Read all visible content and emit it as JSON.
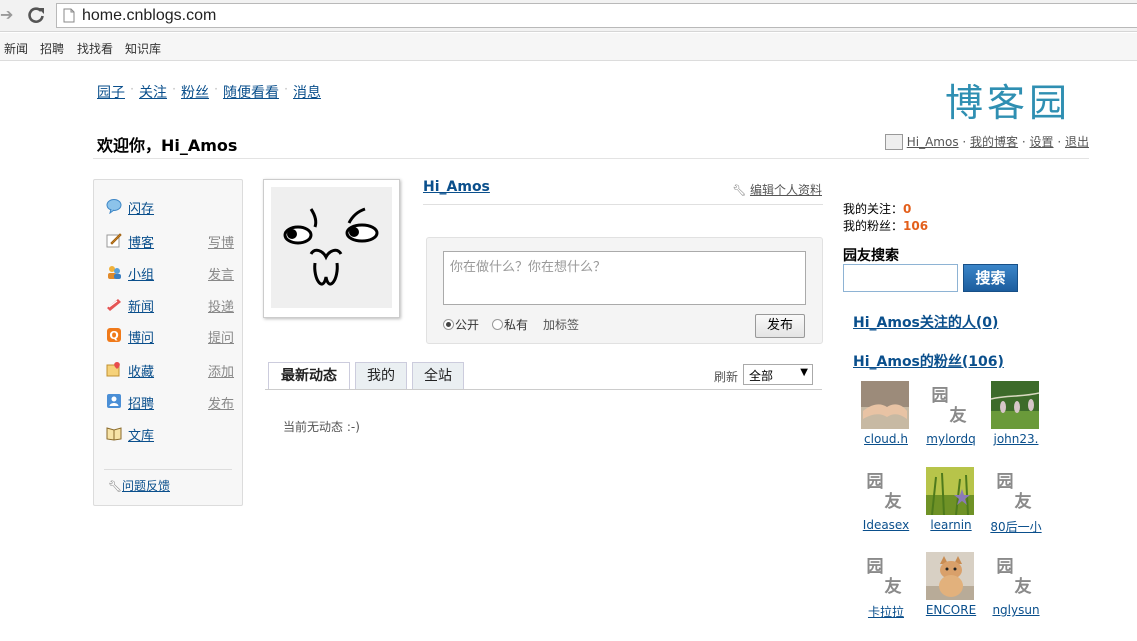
{
  "browser": {
    "url": "home.cnblogs.com",
    "bookmarks": [
      "新闻",
      "招聘",
      "找找看",
      "知识库"
    ]
  },
  "topnav": [
    "园子",
    "关注",
    "粉丝",
    "随便看看",
    "消息"
  ],
  "logo_text": "博客园",
  "welcome": "欢迎你，Hi_Amos",
  "userlinks": {
    "name": "Hi_Amos",
    "my_blog": "我的博客",
    "settings": "设置",
    "logout": "退出"
  },
  "sidebar": {
    "items": [
      {
        "label": "闪存",
        "action": "",
        "icon": "flash-bubble-icon"
      },
      {
        "label": "博客",
        "action": "写博",
        "icon": "blog-pencil-icon"
      },
      {
        "label": "小组",
        "action": "发言",
        "icon": "group-icon"
      },
      {
        "label": "新闻",
        "action": "投递",
        "icon": "news-icon"
      },
      {
        "label": "博问",
        "action": "提问",
        "icon": "question-icon"
      },
      {
        "label": "收藏",
        "action": "添加",
        "icon": "favorite-icon"
      },
      {
        "label": "招聘",
        "action": "发布",
        "icon": "jobs-icon"
      },
      {
        "label": "文库",
        "action": "",
        "icon": "library-book-icon"
      }
    ],
    "feedback": "问题反馈"
  },
  "profile": {
    "name": "Hi_Amos",
    "edit": "编辑个人资料"
  },
  "status": {
    "placeholder": "你在做什么？你在想什么？",
    "public": "公开",
    "private": "私有",
    "add_tag": "加标签",
    "publish": "发布"
  },
  "feed": {
    "tabs": [
      "最新动态",
      "我的",
      "全站"
    ],
    "refresh": "刷新",
    "filter": "全部",
    "empty": "当前无动态 :-)"
  },
  "right": {
    "following_label": "我的关注：",
    "following_count": "0",
    "fans_label": "我的粉丝：",
    "fans_count": "106",
    "search_title": "园友搜索",
    "search_button": "搜索",
    "following_link": "Hi_Amos关注的人(0)",
    "fans_link": "Hi_Amos的粉丝(106)",
    "fans": [
      {
        "name": "cloud.h",
        "avatar": "hands-photo"
      },
      {
        "name": "mylordq",
        "avatar": "default-yuanyou"
      },
      {
        "name": "john23.",
        "avatar": "nature-photo"
      },
      {
        "name": "Ideasex",
        "avatar": "default-yuanyou"
      },
      {
        "name": "learnin",
        "avatar": "flower-photo"
      },
      {
        "name": "80后一小",
        "avatar": "default-yuanyou"
      },
      {
        "name": "卡拉拉",
        "avatar": "default-yuanyou"
      },
      {
        "name": "ENCORE",
        "avatar": "cat-photo"
      },
      {
        "name": "nglysun",
        "avatar": "default-yuanyou"
      }
    ],
    "default_avatar_text": [
      "园",
      "友"
    ]
  }
}
